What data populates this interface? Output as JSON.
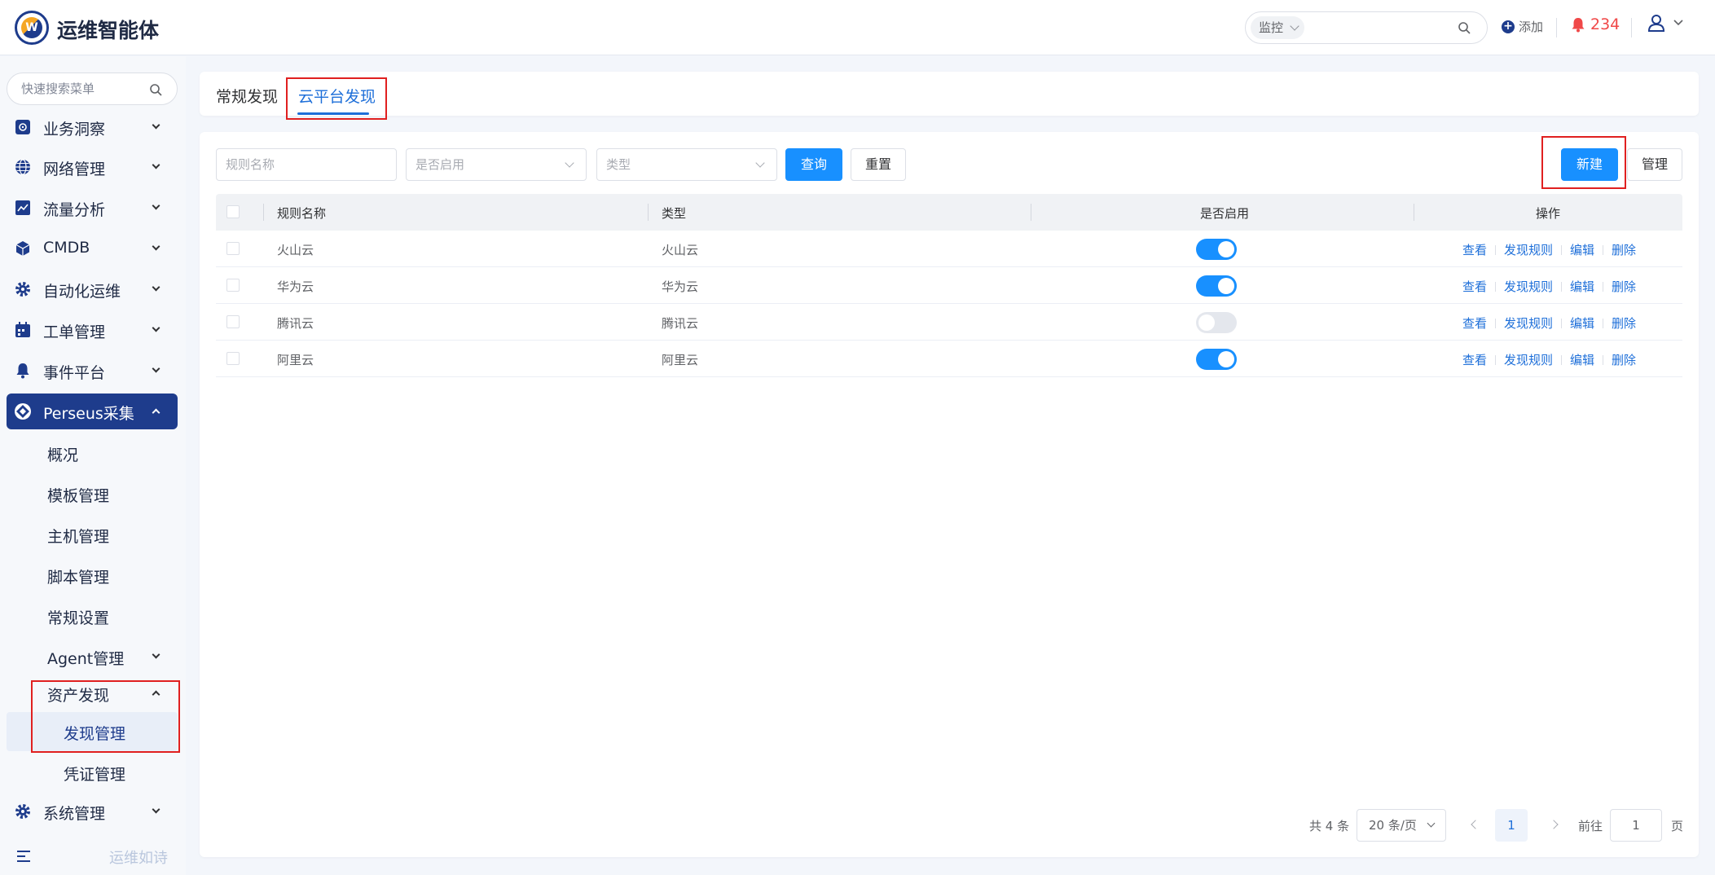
{
  "header": {
    "app_title": "运维智能体",
    "logo_letter": "W",
    "search_scope": "监控",
    "add_label": "添加",
    "alarm_count": "234",
    "icons": [
      "search-icon",
      "plus-icon",
      "bell-icon",
      "user-icon",
      "chevron-down-icon"
    ]
  },
  "sidebar": {
    "search_placeholder": "快速搜索菜单",
    "items": [
      {
        "label": "业务洞察",
        "icon": "insight-icon"
      },
      {
        "label": "网络管理",
        "icon": "globe-icon"
      },
      {
        "label": "流量分析",
        "icon": "chart-icon"
      },
      {
        "label": "CMDB",
        "icon": "cube-icon"
      },
      {
        "label": "自动化运维",
        "icon": "gear-icon"
      },
      {
        "label": "工单管理",
        "icon": "calendar-icon"
      },
      {
        "label": "事件平台",
        "icon": "bell-icon"
      },
      {
        "label": "Perseus采集",
        "icon": "perseus-icon"
      }
    ],
    "perseus_children": [
      "概况",
      "模板管理",
      "主机管理",
      "脚本管理",
      "常规设置",
      "Agent管理",
      "资产发现"
    ],
    "asset_children": [
      "发现管理",
      "凭证管理"
    ],
    "system": {
      "label": "系统管理",
      "icon": "gear-icon"
    },
    "slogan": "运维如诗"
  },
  "tabs": [
    "常规发现",
    "云平台发现"
  ],
  "active_tab": "云平台发现",
  "filters": {
    "rule_name_placeholder": "规则名称",
    "enabled_placeholder": "是否启用",
    "type_placeholder": "类型",
    "query_label": "查询",
    "reset_label": "重置",
    "new_label": "新建",
    "manage_label": "管理"
  },
  "table": {
    "headers": [
      "规则名称",
      "类型",
      "是否启用",
      "操作"
    ],
    "rows": [
      {
        "name": "火山云",
        "type": "火山云",
        "enabled": true
      },
      {
        "name": "华为云",
        "type": "华为云",
        "enabled": true
      },
      {
        "name": "腾讯云",
        "type": "腾讯云",
        "enabled": false
      },
      {
        "name": "阿里云",
        "type": "阿里云",
        "enabled": true
      }
    ],
    "actions": [
      "查看",
      "发现规则",
      "编辑",
      "删除"
    ]
  },
  "pagination": {
    "total": "共 4 条",
    "page_size": "20 条/页",
    "current_page": "1",
    "goto_label": "前往",
    "goto_value": "1",
    "page_suffix": "页"
  },
  "colors": {
    "brand": "#1e3c8c",
    "primary": "#1890ff",
    "link": "#1e6fd9",
    "alarm": "#f04848",
    "highlight": "#e02020"
  }
}
